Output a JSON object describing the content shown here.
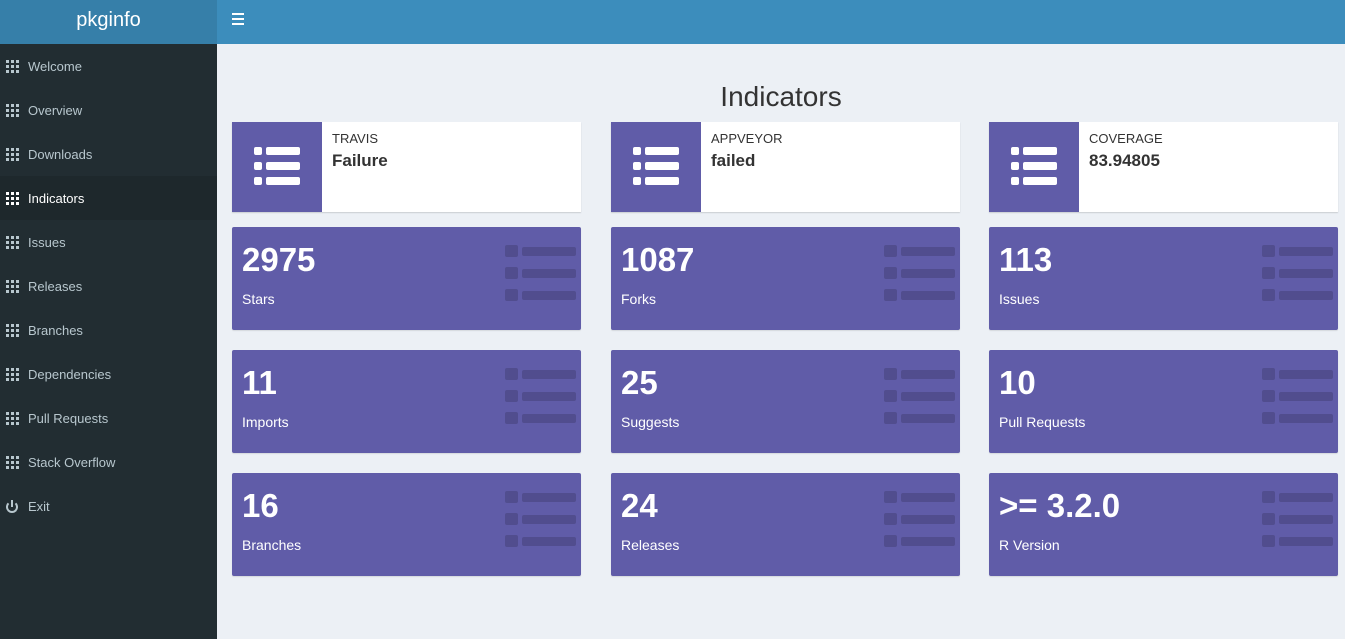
{
  "app": {
    "title": "pkginfo"
  },
  "header": {
    "toggle_icon": "hamburger-icon"
  },
  "sidebar": {
    "items": [
      {
        "label": "Welcome",
        "icon": "grid-icon"
      },
      {
        "label": "Overview",
        "icon": "grid-icon"
      },
      {
        "label": "Downloads",
        "icon": "grid-icon"
      },
      {
        "label": "Indicators",
        "icon": "grid-icon",
        "active": true
      },
      {
        "label": "Issues",
        "icon": "grid-icon"
      },
      {
        "label": "Releases",
        "icon": "grid-icon"
      },
      {
        "label": "Branches",
        "icon": "grid-icon"
      },
      {
        "label": "Dependencies",
        "icon": "grid-icon"
      },
      {
        "label": "Pull Requests",
        "icon": "grid-icon"
      },
      {
        "label": "Stack Overflow",
        "icon": "grid-icon"
      },
      {
        "label": "Exit",
        "icon": "power-icon"
      }
    ]
  },
  "main": {
    "title": "Indicators",
    "infoboxes": [
      {
        "label": "TRAVIS",
        "value": "Failure",
        "icon": "list-icon"
      },
      {
        "label": "APPVEYOR",
        "value": "failed",
        "icon": "list-icon"
      },
      {
        "label": "COVERAGE",
        "value": "83.94805",
        "icon": "list-icon"
      }
    ],
    "valueboxes": [
      {
        "value": "2975",
        "label": "Stars",
        "icon": "list-icon"
      },
      {
        "value": "1087",
        "label": "Forks",
        "icon": "list-icon"
      },
      {
        "value": "113",
        "label": "Issues",
        "icon": "list-icon"
      },
      {
        "value": "11",
        "label": "Imports",
        "icon": "list-icon"
      },
      {
        "value": "25",
        "label": "Suggests",
        "icon": "list-icon"
      },
      {
        "value": "10",
        "label": "Pull Requests",
        "icon": "list-icon"
      },
      {
        "value": "16",
        "label": "Branches",
        "icon": "list-icon"
      },
      {
        "value": "24",
        "label": "Releases",
        "icon": "list-icon"
      },
      {
        "value": ">= 3.2.0",
        "label": "R Version",
        "icon": "list-icon"
      }
    ]
  },
  "colors": {
    "header": "#3c8dbc",
    "logo_bg": "#367fa9",
    "sidebar": "#222d32",
    "box_purple": "#605ca8",
    "content_bg": "#ecf0f5"
  }
}
